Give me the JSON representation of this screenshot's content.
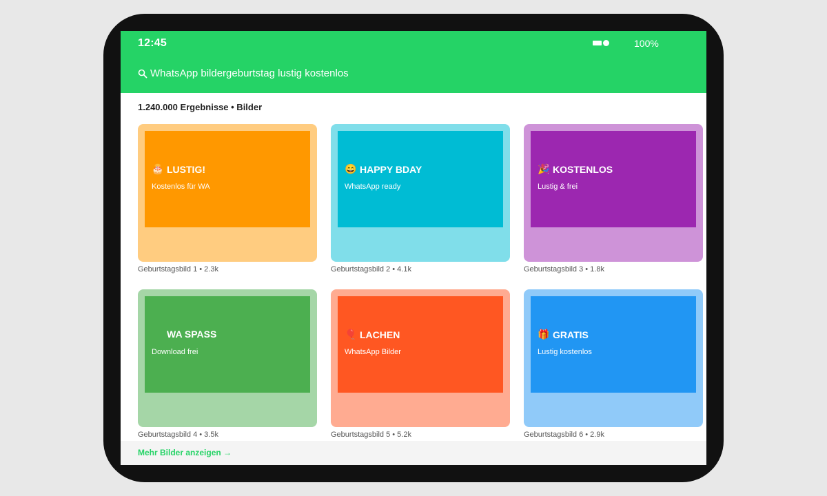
{
  "status_bar": {
    "time": "12:45",
    "battery": "100%"
  },
  "search": {
    "icon": "search-icon",
    "query": "WhatsApp bildergeburtstag lustig kostenlos"
  },
  "results_info": "1.240.000 Ergebnisse • Bilder",
  "colors": {
    "accent": "#25d366"
  },
  "cards": [
    {
      "emoji": "🎂",
      "icon": "cake-icon",
      "title": "LUSTIG!",
      "subtitle": "Kostenlos für WA",
      "caption": "Geburtstagsbild 1 • 2.3k",
      "color": "#ff9800",
      "light": "#ffcc80"
    },
    {
      "emoji": "😄",
      "icon": "smile-icon",
      "title": "HAPPY BDAY",
      "subtitle": "WhatsApp ready",
      "caption": "Geburtstagsbild 2 • 4.1k",
      "color": "#00bcd4",
      "light": "#80deea"
    },
    {
      "emoji": "🎉",
      "icon": "party-popper-icon",
      "title": "KOSTENLOS",
      "subtitle": "Lustig & frei",
      "caption": "Geburtstagsbild 3 • 1.8k",
      "color": "#9c27b0",
      "light": "#ce93d8"
    },
    {
      "emoji": "",
      "icon": "",
      "title": "WA SPASS",
      "subtitle": "Download frei",
      "caption": "Geburtstagsbild 4 • 3.5k",
      "color": "#4caf50",
      "light": "#a5d6a7"
    },
    {
      "emoji": "🎈",
      "icon": "balloon-icon",
      "title": "LACHEN",
      "subtitle": "WhatsApp Bilder",
      "caption": "Geburtstagsbild 5 • 5.2k",
      "color": "#ff5722",
      "light": "#ffab91"
    },
    {
      "emoji": "🎁",
      "icon": "gift-icon",
      "title": "GRATIS",
      "subtitle": "Lustig kostenlos",
      "caption": "Geburtstagsbild 6 • 2.9k",
      "color": "#2196f3",
      "light": "#90caf9"
    }
  ],
  "footer": {
    "more_label": "Mehr Bilder anzeigen →"
  }
}
